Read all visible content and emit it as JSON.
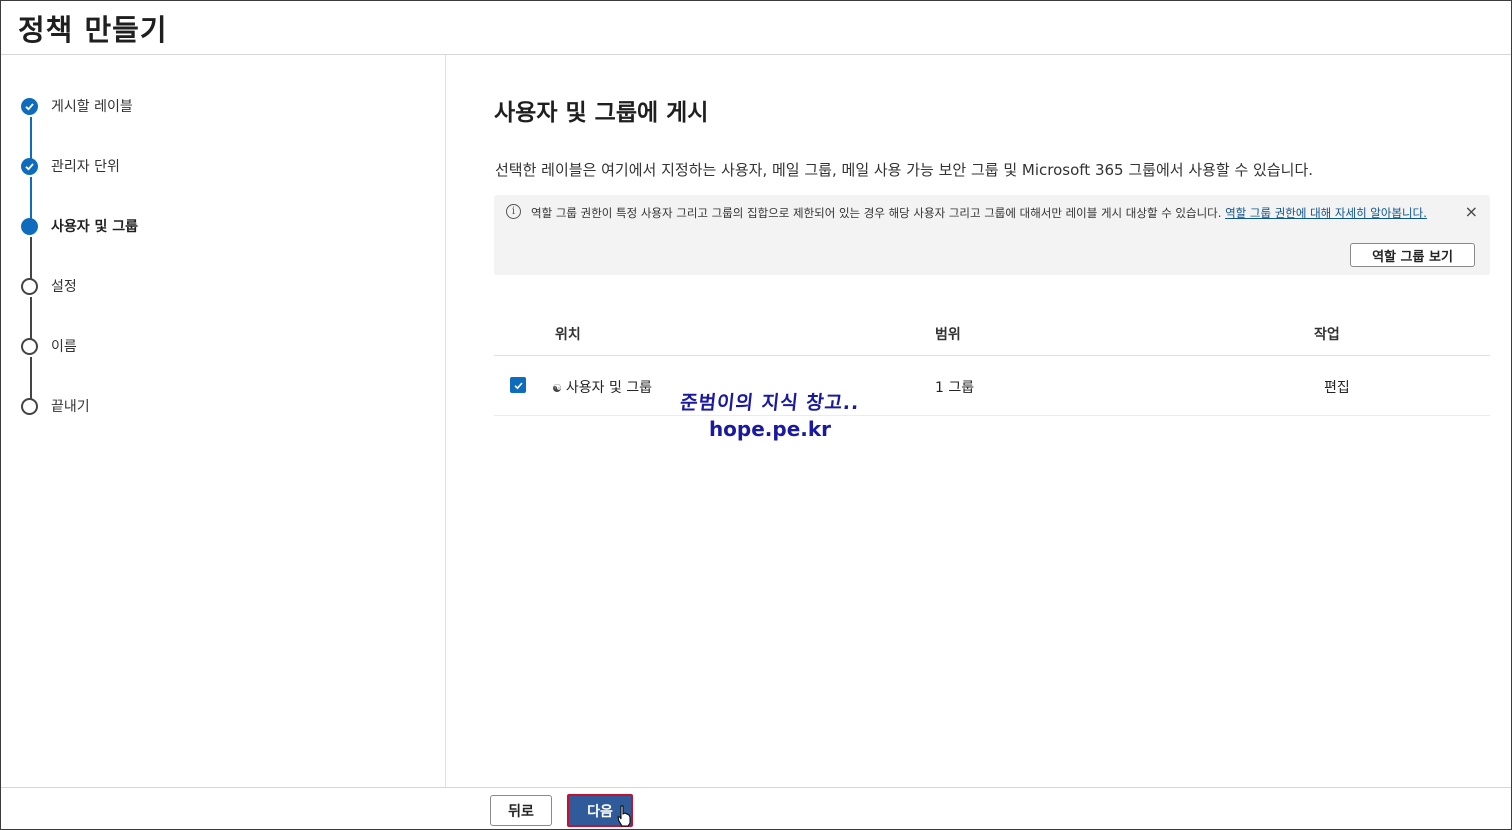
{
  "header": {
    "title": "정책 만들기"
  },
  "steps": [
    {
      "label": "게시할 레이블",
      "state": "done"
    },
    {
      "label": "관리자 단위",
      "state": "done"
    },
    {
      "label": "사용자 및 그룹",
      "state": "current"
    },
    {
      "label": "설정",
      "state": "todo"
    },
    {
      "label": "이름",
      "state": "todo"
    },
    {
      "label": "끝내기",
      "state": "todo"
    }
  ],
  "main": {
    "title": "사용자 및 그룹에 게시",
    "description": "선택한 레이블은 여기에서 지정하는 사용자, 메일 그룹, 메일 사용 가능 보안 그룹 및 Microsoft 365 그룹에서 사용할 수 있습니다.",
    "info": {
      "text": "역할 그룹 권한이 특정 사용자 그리고 그룹의 집합으로 제한되어 있는 경우 해당 사용자 그리고 그룹에 대해서만 레이블 게시 대상할 수 있습니다.",
      "link": "역할 그룹 권한에 대해 자세히 알아봅니다.",
      "close_icon": "×",
      "button": "역할 그룹 보기"
    },
    "table": {
      "columns": [
        "위치",
        "범위",
        "작업"
      ],
      "rows": [
        {
          "checked": true,
          "icon": "group-icon",
          "location": "사용자 및 그룹",
          "scope": "1 그룹",
          "action": "편집"
        }
      ]
    }
  },
  "watermark": {
    "line1": "준범이의 지식 창고..",
    "line2": "hope.pe.kr"
  },
  "footer": {
    "back_label": "뒤로",
    "next_label": "다음"
  },
  "colors": {
    "accent": "#0f6cbd",
    "next_button": "#2f5b9a",
    "highlight_border": "#c8102e"
  }
}
